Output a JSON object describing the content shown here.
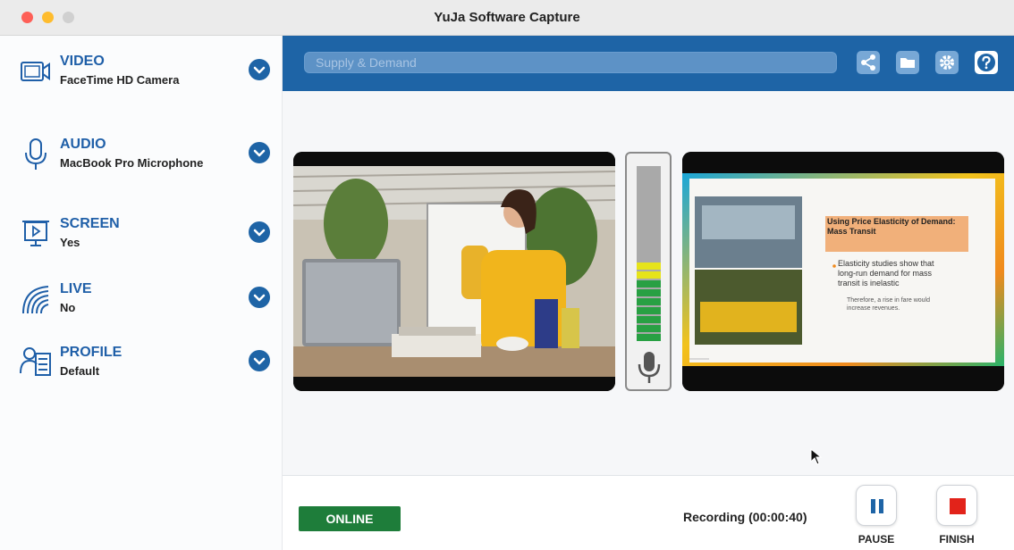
{
  "window": {
    "title": "YuJa Software Capture"
  },
  "sidebar": {
    "sources": [
      {
        "label": "VIDEO",
        "value": "FaceTime HD Camera",
        "icon": "video-camera-icon"
      },
      {
        "label": "AUDIO",
        "value": "MacBook Pro Microphone",
        "icon": "microphone-icon"
      },
      {
        "label": "SCREEN",
        "value": "Yes",
        "icon": "screen-presentation-icon"
      },
      {
        "label": "LIVE",
        "value": "No",
        "icon": "live-stream-icon"
      },
      {
        "label": "PROFILE",
        "value": "Default",
        "icon": "profile-icon"
      }
    ]
  },
  "toolbar": {
    "title_placeholder": "Supply & Demand",
    "icons": [
      "share-icon",
      "folder-icon",
      "settings-icon",
      "help-icon"
    ]
  },
  "slide": {
    "heading": "Using Price Elasticity of Demand: Mass Transit",
    "bullet": "Elasticity studies show that long-run demand for mass transit is inelastic",
    "sub_bullet": "Therefore, a rise in fare would increase revenues."
  },
  "audio_meter": {
    "level": 0.47,
    "segments": 12,
    "lit_green": 7,
    "lit_yellow": 2
  },
  "status": {
    "connection": "ONLINE",
    "recording": "Recording (00:00:40)",
    "pause_label": "PAUSE",
    "finish_label": "FINISH"
  },
  "colors": {
    "brand_blue": "#1e64a6",
    "online_green": "#1e7d3a",
    "stop_red": "#e2231a",
    "pause_blue": "#1e64a6",
    "meter_green": "#28a043",
    "meter_yellow": "#e6e31a"
  }
}
